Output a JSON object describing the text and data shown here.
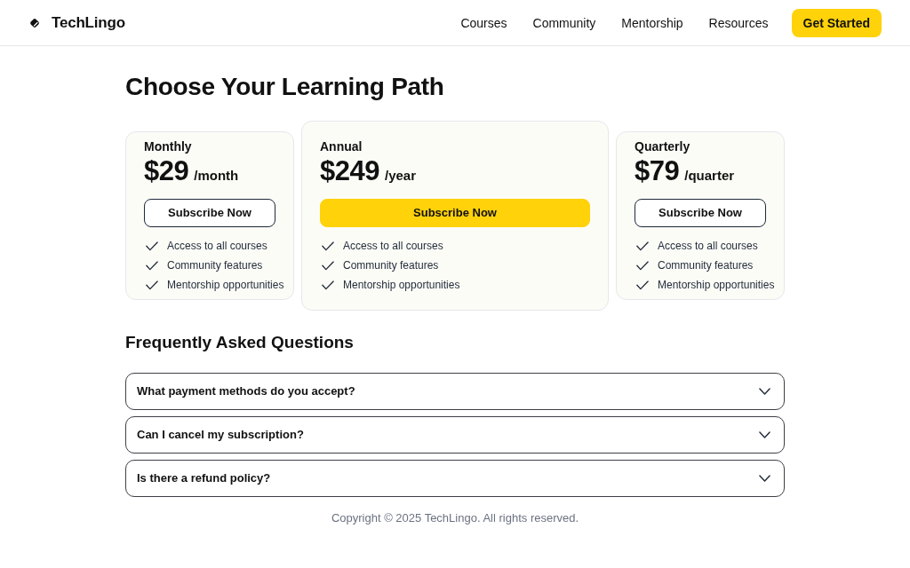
{
  "header": {
    "logo": "TechLingo",
    "nav": [
      "Courses",
      "Community",
      "Mentorship",
      "Resources"
    ],
    "cta": "Get Started"
  },
  "title": "Choose Your Learning Path",
  "plans": [
    {
      "name": "Monthly",
      "price": "$29",
      "period": "/month",
      "button": "Subscribe Now",
      "featured": false,
      "features": [
        "Access to all courses",
        "Community features",
        "Mentorship opportunities"
      ]
    },
    {
      "name": "Annual",
      "price": "$249",
      "period": "/year",
      "button": "Subscribe Now",
      "featured": true,
      "features": [
        "Access to all courses",
        "Community features",
        "Mentorship opportunities"
      ]
    },
    {
      "name": "Quarterly",
      "price": "$79",
      "period": "/quarter",
      "button": "Subscribe Now",
      "featured": false,
      "features": [
        "Access to all courses",
        "Community features",
        "Mentorship opportunities"
      ]
    }
  ],
  "faq": {
    "title": "Frequently Asked Questions",
    "items": [
      {
        "question": "What payment methods do you accept?",
        "expanded": false
      },
      {
        "question": "Can I cancel my subscription?",
        "expanded": false
      },
      {
        "question": "Is there a refund policy?",
        "expanded": false
      }
    ]
  },
  "footer": "Copyright © 2025 TechLingo. All rights reserved."
}
